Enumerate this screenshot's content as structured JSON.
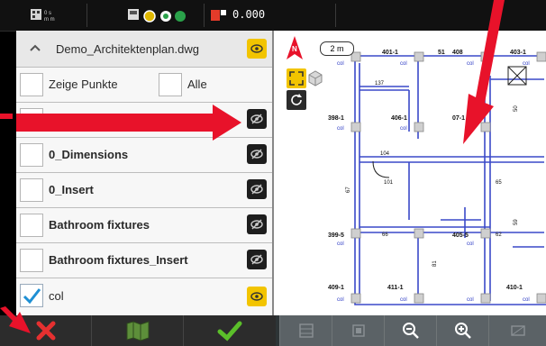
{
  "status": {
    "coordinate": "0.000",
    "mini_text_1": "0 s\nm m"
  },
  "file": {
    "name": "Demo_Architektenplan.dwg"
  },
  "options": {
    "show_points": "Zeige Punkte",
    "all": "Alle"
  },
  "layers": [
    {
      "label": "0",
      "checked": false,
      "visible_style": "dark"
    },
    {
      "label": "0_Dimensions",
      "checked": false,
      "visible_style": "dark"
    },
    {
      "label": "0_Insert",
      "checked": false,
      "visible_style": "dark"
    },
    {
      "label": "Bathroom fixtures",
      "checked": false,
      "visible_style": "dark"
    },
    {
      "label": "Bathroom fixtures_Insert",
      "checked": false,
      "visible_style": "dark"
    },
    {
      "label": "col",
      "checked": true,
      "visible_style": "yellow"
    }
  ],
  "map": {
    "scale": "2 m",
    "north": "N",
    "labels": {
      "a": "401-1",
      "b": "51",
      "c": "408",
      "d": "403-1",
      "e": "398-1",
      "f": "406-1",
      "g": "07-1",
      "h": "399-5",
      "i": "405-5",
      "j": "409-1",
      "k": "411-1",
      "l": "410-1",
      "col": "col",
      "n137": "137",
      "n104": "104",
      "n101": "101",
      "n65": "65",
      "n67": "67",
      "n66": "66",
      "n62": "62",
      "n50": "50",
      "n59": "59",
      "n81": "81"
    }
  },
  "colors": {
    "accent_yellow": "#f2c400",
    "arrow_red": "#e8122a",
    "confirm_green": "#5bbf2a",
    "cancel_red": "#e53030"
  },
  "icons": {
    "cancel": "x-icon",
    "map": "map-icon",
    "confirm": "check-icon"
  }
}
